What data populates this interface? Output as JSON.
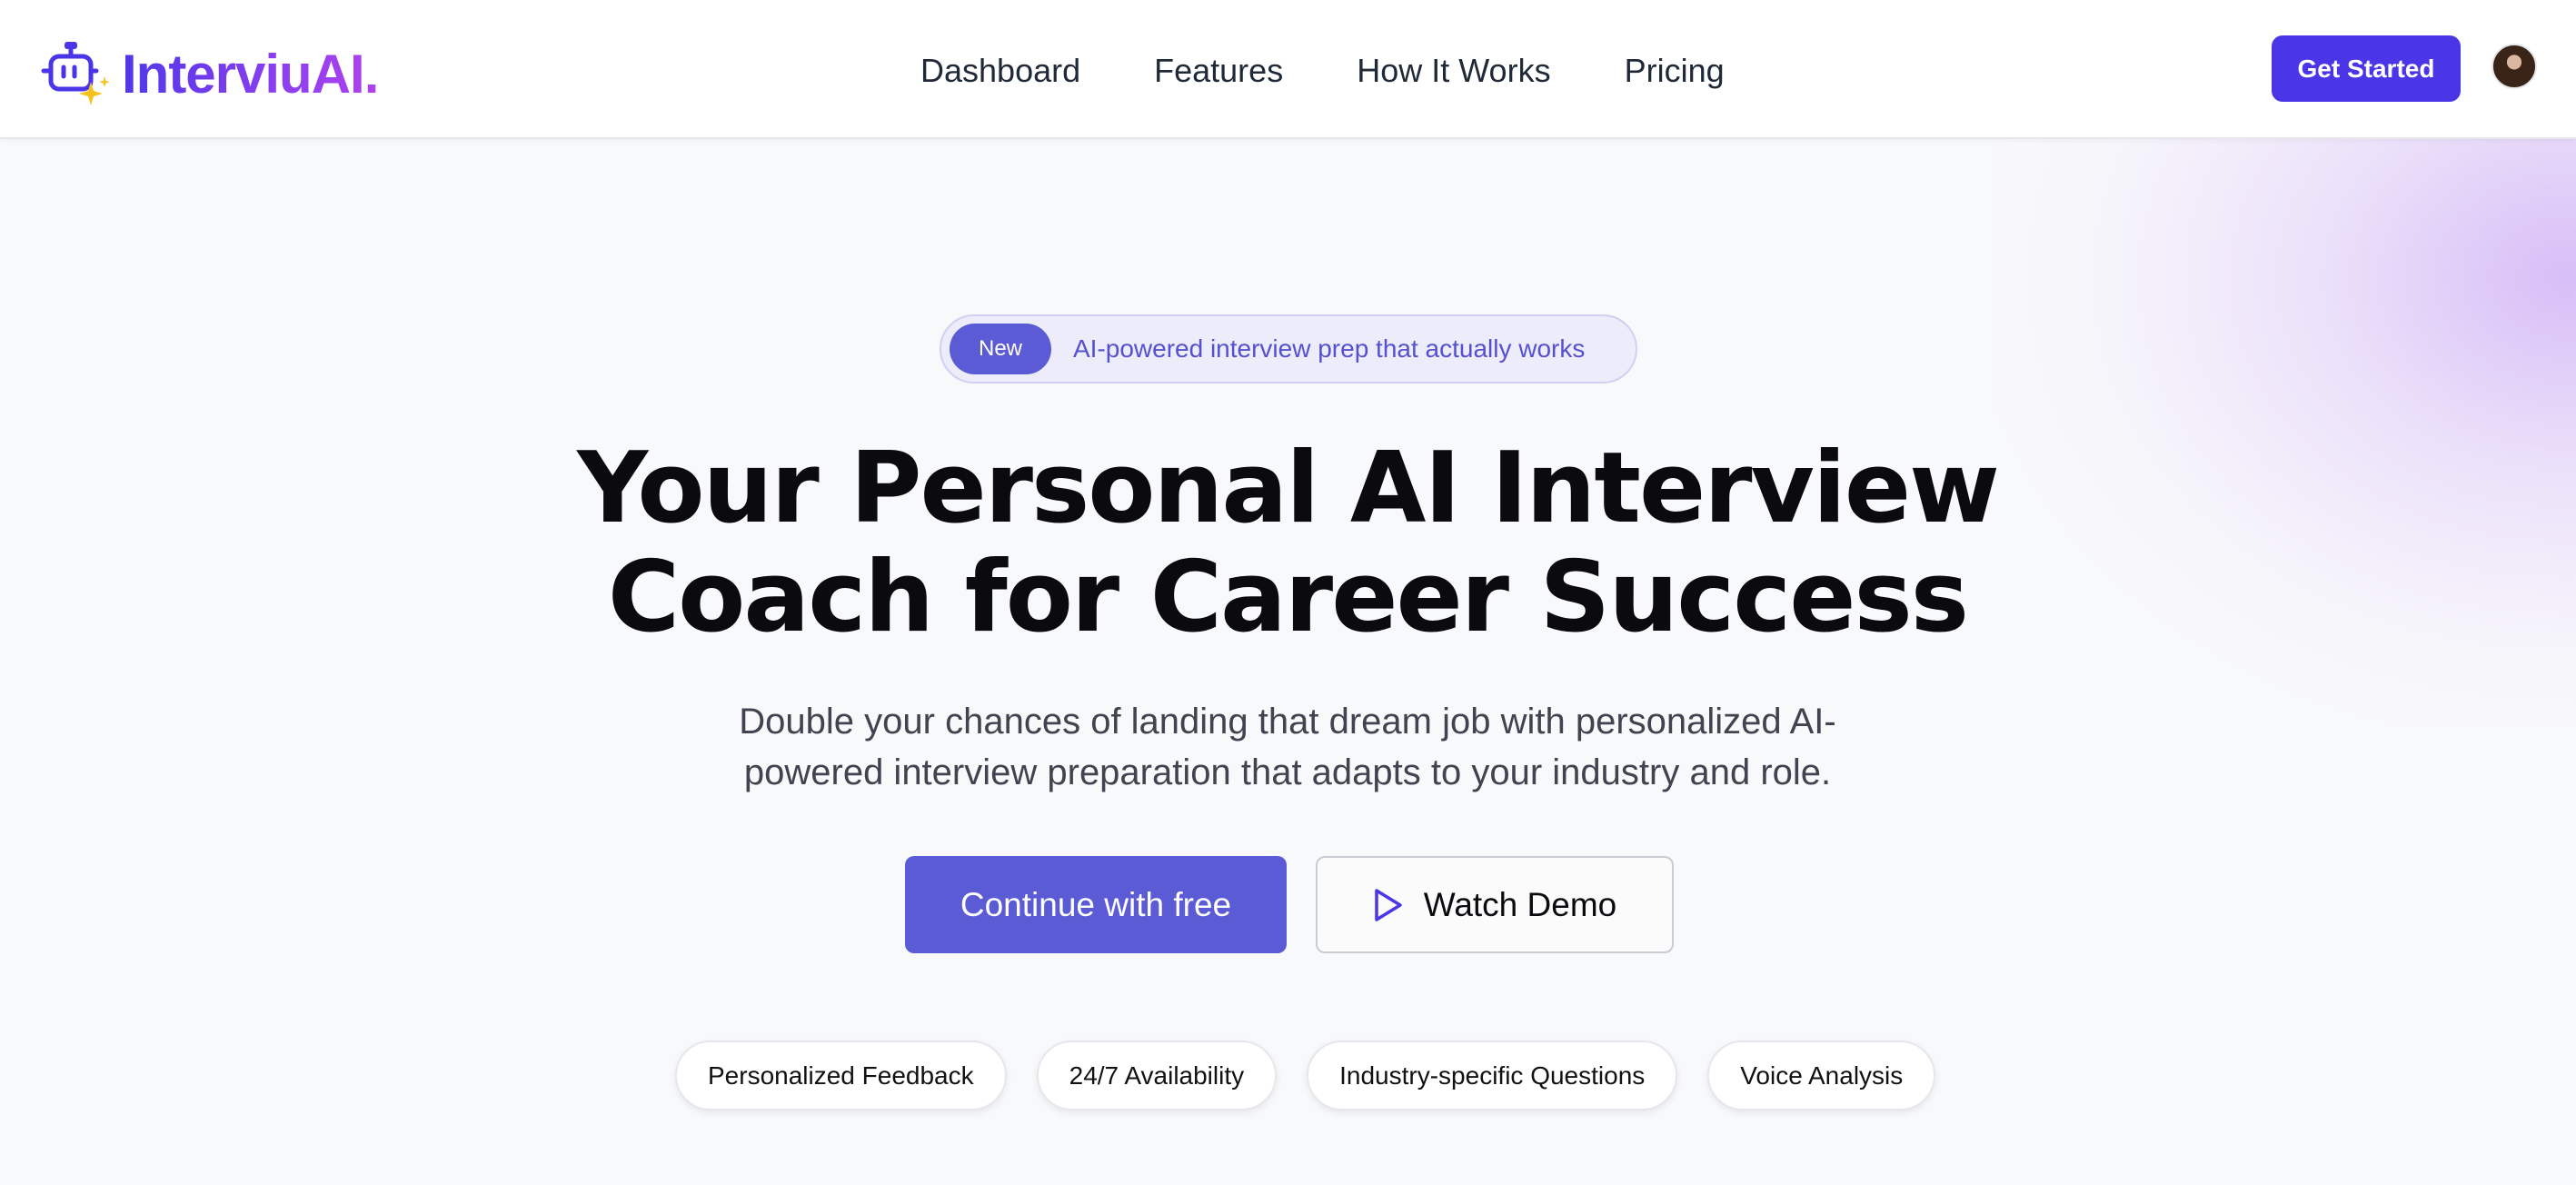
{
  "brand": {
    "name": "InterviuAI.",
    "accent": "#4a36e6",
    "gradient_end": "#b041ee"
  },
  "nav": {
    "items": [
      {
        "label": "Dashboard"
      },
      {
        "label": "Features"
      },
      {
        "label": "How It Works"
      },
      {
        "label": "Pricing"
      }
    ]
  },
  "header": {
    "cta_label": "Get Started",
    "avatar_icon": "user-avatar"
  },
  "hero": {
    "badge_tag": "New",
    "badge_text": "AI-powered interview prep that actually works",
    "headline_line1": "Your Personal AI Interview",
    "headline_line2": "Coach for Career Success",
    "subtitle_line1": "Double your chances of landing that dream job with personalized AI-",
    "subtitle_line2": "powered interview preparation that adapts to your industry and role.",
    "primary_button": "Continue with free",
    "secondary_button": "Watch Demo",
    "secondary_icon": "play-icon",
    "button_color": "#5b5bd6"
  },
  "features": [
    {
      "label": "Personalized Feedback"
    },
    {
      "label": "24/7 Availability"
    },
    {
      "label": "Industry-specific Questions"
    },
    {
      "label": "Voice Analysis"
    }
  ]
}
